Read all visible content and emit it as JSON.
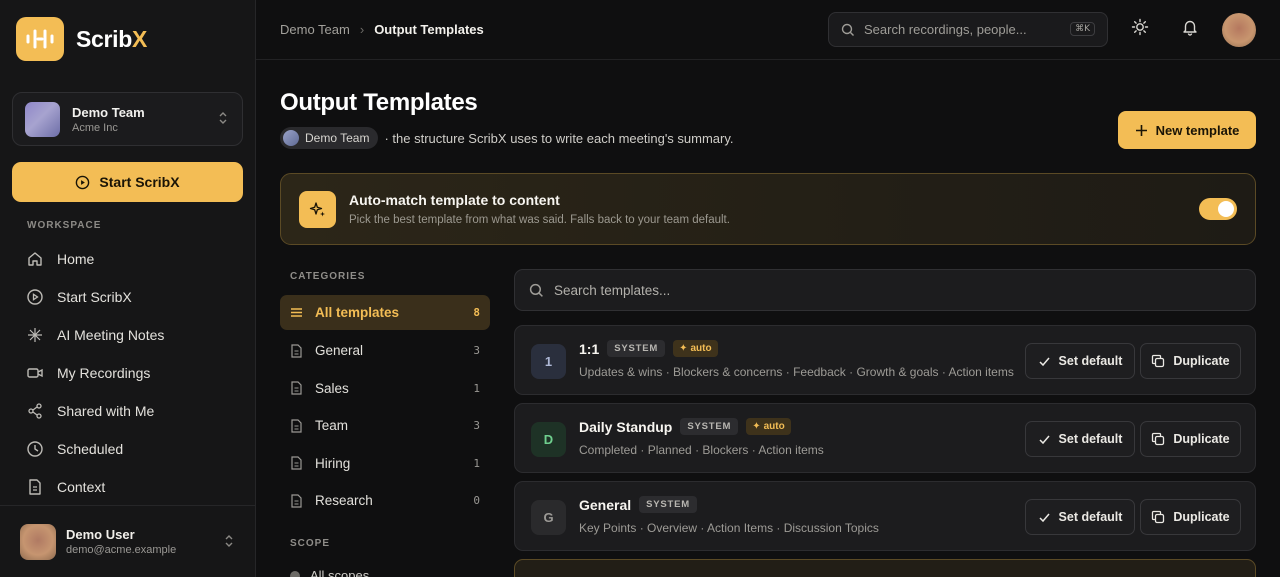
{
  "brand": {
    "name_main": "Scrib",
    "name_accent": "X",
    "accent_color": "#f3bd55"
  },
  "team_switcher": {
    "name": "Demo Team",
    "org": "Acme Inc"
  },
  "start_button": {
    "label": "Start ScribX"
  },
  "sidebar": {
    "section_label": "WORKSPACE",
    "items": [
      {
        "label": "Home",
        "icon": "home-icon"
      },
      {
        "label": "Start ScribX",
        "icon": "play-circle-icon"
      },
      {
        "label": "AI Meeting Notes",
        "icon": "sparkle-icon"
      },
      {
        "label": "My Recordings",
        "icon": "video-icon"
      },
      {
        "label": "Shared with Me",
        "icon": "share-icon"
      },
      {
        "label": "Scheduled",
        "icon": "clock-icon"
      },
      {
        "label": "Context",
        "icon": "document-icon"
      }
    ]
  },
  "user": {
    "name": "Demo User",
    "email": "demo@acme.example"
  },
  "topbar": {
    "breadcrumb": [
      "Demo Team",
      "Output Templates"
    ],
    "search_placeholder": "Search recordings, people...",
    "search_shortcut": "⌘K"
  },
  "page": {
    "title": "Output Templates",
    "team_chip": "Demo Team",
    "subtitle": "· the structure ScribX uses to write each meeting's summary.",
    "new_button": "New template"
  },
  "auto_match": {
    "title": "Auto-match template to content",
    "description": "Pick the best template from what was said. Falls back to your team default.",
    "enabled": true
  },
  "categories": {
    "label": "CATEGORIES",
    "items": [
      {
        "label": "All templates",
        "count": "8",
        "active": true
      },
      {
        "label": "General",
        "count": "3"
      },
      {
        "label": "Sales",
        "count": "1"
      },
      {
        "label": "Team",
        "count": "3"
      },
      {
        "label": "Hiring",
        "count": "1"
      },
      {
        "label": "Research",
        "count": "0"
      }
    ]
  },
  "scope": {
    "label": "SCOPE",
    "first_item": "All scopes"
  },
  "template_search": {
    "placeholder": "Search templates..."
  },
  "templates": [
    {
      "badge": "1",
      "name": "1:1",
      "system_tag": "SYSTEM",
      "auto_tag": "auto",
      "description": "Updates & wins · Blockers & concerns · Feedback · Growth & goals · Action items",
      "set_default": "Set default",
      "duplicate": "Duplicate"
    },
    {
      "badge": "D",
      "name": "Daily Standup",
      "system_tag": "SYSTEM",
      "auto_tag": "auto",
      "description": "Completed · Planned · Blockers · Action items",
      "set_default": "Set default",
      "duplicate": "Duplicate"
    },
    {
      "badge": "G",
      "name": "General",
      "system_tag": "SYSTEM",
      "description": "Key Points · Overview · Action Items · Discussion Topics",
      "set_default": "Set default",
      "duplicate": "Duplicate"
    }
  ]
}
